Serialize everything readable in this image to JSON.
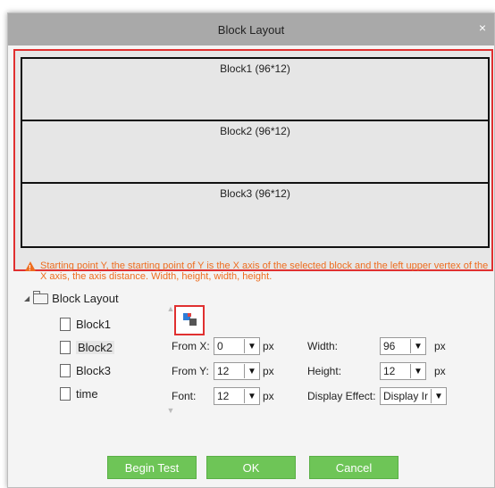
{
  "dialog": {
    "title": "Block Layout",
    "close_icon": "×"
  },
  "blocks": [
    {
      "label": "Block1 (96*12)"
    },
    {
      "label": "Block2 (96*12)"
    },
    {
      "label": "Block3 (96*12)"
    }
  ],
  "warning": "Starting point Y, the starting point of Y is the X axis of the selected block and the left upper vertex of the X axis, the axis distance. Width, height, width, height.",
  "tree": {
    "root": "Block Layout",
    "items": [
      "Block1",
      "Block2",
      "Block3",
      "time"
    ],
    "selected": "Block2"
  },
  "form": {
    "from_x": {
      "label": "From X:",
      "value": "0",
      "unit": "px"
    },
    "from_y": {
      "label": "From Y:",
      "value": "12",
      "unit": "px"
    },
    "font": {
      "label": "Font:",
      "value": "12",
      "unit": "px"
    },
    "width": {
      "label": "Width:",
      "value": "96",
      "unit": "px"
    },
    "height": {
      "label": "Height:",
      "value": "12",
      "unit": "px"
    },
    "display_effect": {
      "label": "Display Effect:",
      "value": "Display Ir"
    }
  },
  "buttons": {
    "begin_test": "Begin Test",
    "ok": "OK",
    "cancel": "Cancel"
  },
  "colors": {
    "accent_red": "#e03030",
    "warning_orange": "#ee6d1f",
    "button_green": "#6ec557"
  }
}
